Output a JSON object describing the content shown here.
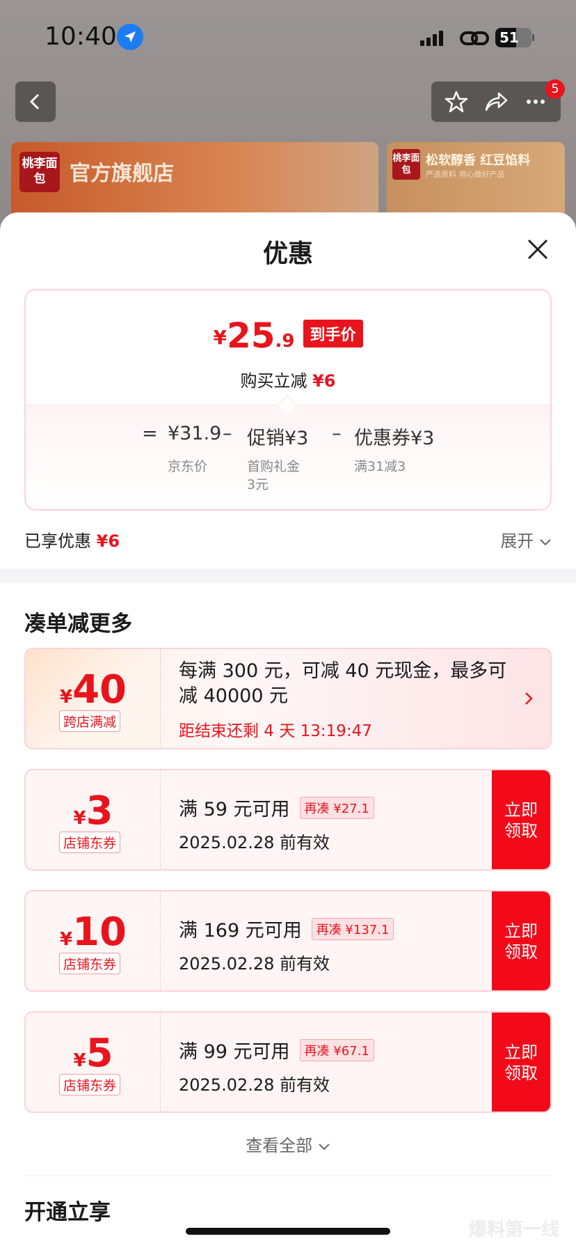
{
  "status_bar": {
    "time": "10:40",
    "battery": "51"
  },
  "nav": {
    "cart_badge": "5"
  },
  "banners": {
    "main_logo": "桃李面包",
    "main_title": "官方旗舰店",
    "side_logo": "桃李面包",
    "side_title": "松软醇香 红豆馅料",
    "side_subtitle": "严选原料 用心做好产品"
  },
  "sheet": {
    "title": "优惠",
    "final_price": {
      "currency": "¥",
      "integer": "25",
      "decimal": ".9",
      "tag": "到手价"
    },
    "instant_reduce": {
      "label": "购买立减",
      "amount": "¥6"
    },
    "formula": {
      "equals": "=",
      "base_value": "¥31.9",
      "base_label": "京东价",
      "minus1": "–",
      "promo_value": "促销¥3",
      "promo_label_line1": "首购礼金",
      "promo_label_line2": "3元",
      "minus2": "–",
      "coupon_value": "优惠券¥3",
      "coupon_label": "满31减3"
    },
    "enjoyed": {
      "label": "已享优惠",
      "amount": "¥6"
    },
    "expand_label": "展开"
  },
  "more_section": {
    "title": "凑单减更多",
    "promo": {
      "currency": "¥",
      "amount": "40",
      "tag": "跨店满减",
      "desc": "每满 300 元，可减 40 元现金，最多可减 40000 元",
      "countdown": "距结束还剩 4 天 13:19:47"
    },
    "coupons": [
      {
        "currency": "¥",
        "amount": "3",
        "tag": "店铺东券",
        "condition": "满 59 元可用",
        "extra": "再凑 ¥27.1",
        "valid": "2025.02.28 前有效",
        "button": "立即领取"
      },
      {
        "currency": "¥",
        "amount": "10",
        "tag": "店铺东券",
        "condition": "满 169 元可用",
        "extra": "再凑 ¥137.1",
        "valid": "2025.02.28 前有效",
        "button": "立即领取"
      },
      {
        "currency": "¥",
        "amount": "5",
        "tag": "店铺东券",
        "condition": "满 99 元可用",
        "extra": "再凑 ¥67.1",
        "valid": "2025.02.28 前有效",
        "button": "立即领取"
      }
    ],
    "see_all": "查看全部"
  },
  "open_section": {
    "title": "开通立享"
  },
  "watermark": "爆料第一线",
  "colors": {
    "accent": "#e8141d",
    "button": "#f30a19"
  }
}
